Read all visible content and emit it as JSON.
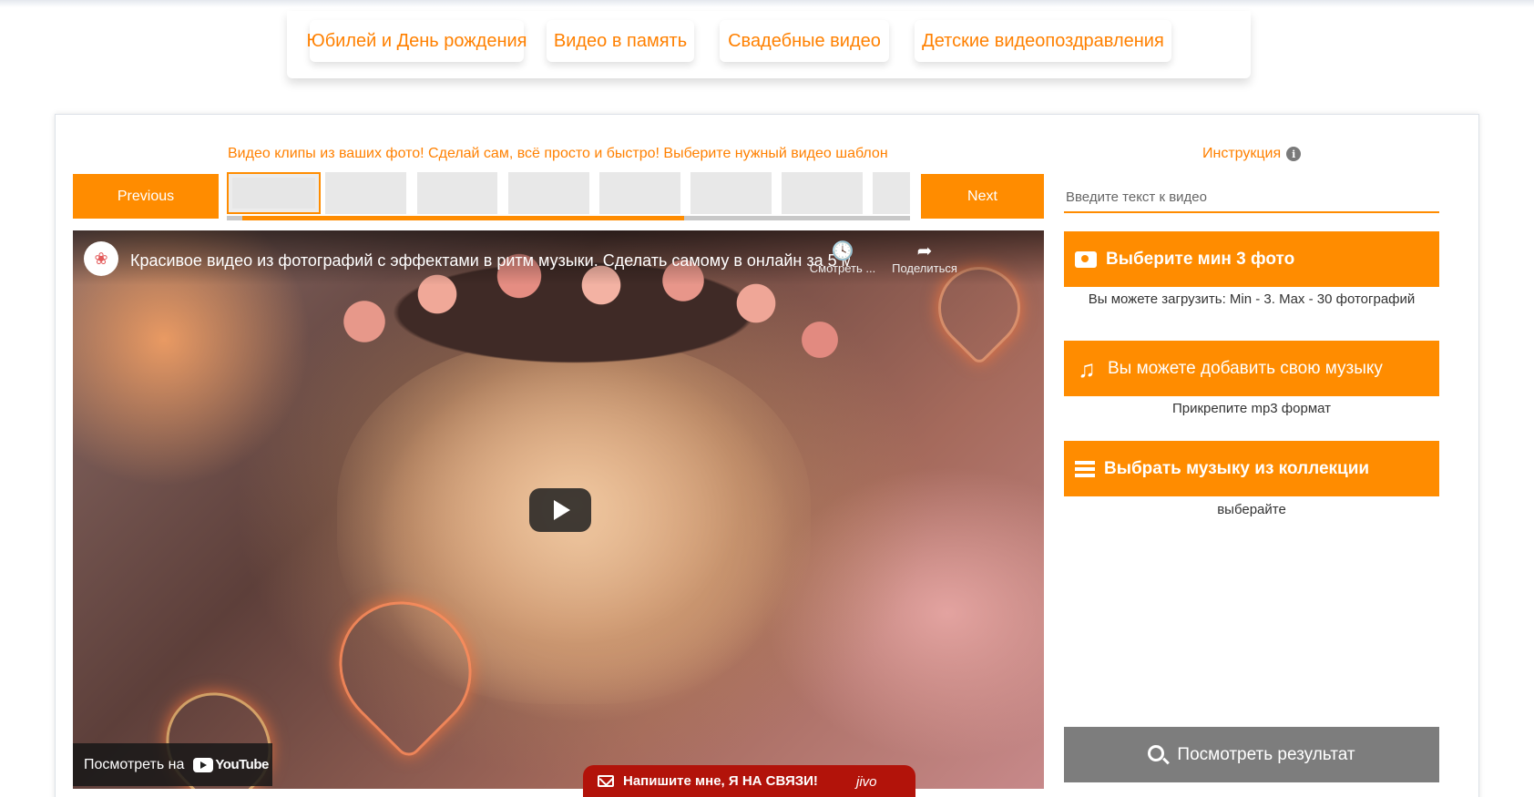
{
  "categories": [
    "Юбилей и День рождения",
    "Видео в память",
    "Свадебные видео",
    "Детские видеопоздравления"
  ],
  "editor": {
    "tagline": "Видео клипы из ваших фото! Сделай сам, всё просто и быстро! Выберите нужный видео шаблон",
    "previous_label": "Previous",
    "next_label": "Next",
    "thumbnail_count": 8
  },
  "video": {
    "title": "Красивое видео из фотографий с эффектами в ритм музыки. Сделать самому в онлайн за 5 минут",
    "watch_later_label": "Смотреть ...",
    "share_label": "Поделиться",
    "watch_on_label": "Посмотреть на",
    "youtube_label": "YouTube"
  },
  "sidebar": {
    "instruction_label": "Инструкция",
    "text_placeholder": "Введите текст к видео",
    "photo_button": "Выберите мин 3 фото",
    "photo_hint": "Вы можете загрузить: Min - 3. Max - 30 фотографий",
    "music_button": "Вы можете добавить свою музыку",
    "music_hint": "Прикрепите mp3 формат",
    "collection_button": "Выбрать музыку из коллекции",
    "collection_hint": "выберайте",
    "result_button": "Посмотреть результат"
  },
  "chat": {
    "message": "Напишите мне, Я НА СВЯЗИ!",
    "brand": "jivo"
  },
  "colors": {
    "accent": "#ff8c00",
    "accent_text": "#ff8000",
    "disabled": "#7d7d7d",
    "chat_bg": "#b2130a"
  }
}
